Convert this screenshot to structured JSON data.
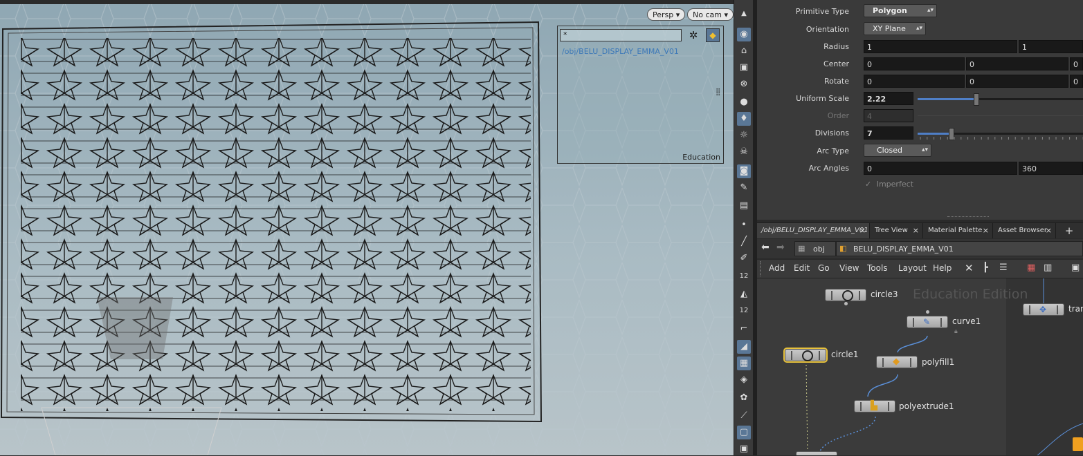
{
  "viewport": {
    "persp_label": "Persp",
    "cam_label": "No cam",
    "display_input": "*",
    "display_path": "/obj/BELU_DISPLAY_EMMA_V01",
    "edition_label": "Education"
  },
  "params": {
    "primitive_type": {
      "label": "Primitive Type",
      "value": "Polygon"
    },
    "orientation": {
      "label": "Orientation",
      "value": "XY Plane"
    },
    "radius": {
      "label": "Radius",
      "values": [
        "1",
        "1"
      ]
    },
    "center": {
      "label": "Center",
      "values": [
        "0",
        "0",
        "0"
      ]
    },
    "rotate": {
      "label": "Rotate",
      "values": [
        "0",
        "0",
        "0"
      ]
    },
    "uniform_scale": {
      "label": "Uniform Scale",
      "value": "2.22",
      "slider_fraction": 0.35
    },
    "order": {
      "label": "Order",
      "value": "4"
    },
    "divisions": {
      "label": "Divisions",
      "value": "7",
      "slider_fraction": 0.2
    },
    "arc_type": {
      "label": "Arc Type",
      "value": "Closed"
    },
    "arc_angles": {
      "label": "Arc Angles",
      "values": [
        "0",
        "360"
      ]
    },
    "imperfect": {
      "label": "Imperfect"
    }
  },
  "tabs": [
    {
      "label": "/obj/BELU_DISPLAY_EMMA_V01"
    },
    {
      "label": "Tree View"
    },
    {
      "label": "Material Palette"
    },
    {
      "label": "Asset Browser"
    }
  ],
  "path": {
    "root": "obj",
    "current": "BELU_DISPLAY_EMMA_V01"
  },
  "menu": [
    "Add",
    "Edit",
    "Go",
    "View",
    "Tools",
    "Layout",
    "Help"
  ],
  "network": {
    "watermark": "Education Edition",
    "nodes": [
      {
        "name": "circle3"
      },
      {
        "name": "curve1"
      },
      {
        "name": "circle1"
      },
      {
        "name": "polyfill1"
      },
      {
        "name": "polyextrude1"
      },
      {
        "name": "tran"
      }
    ]
  },
  "colors": {
    "selection": "#e8c23c",
    "accent": "#4f7fc7",
    "wire": "#5a8fd8"
  }
}
